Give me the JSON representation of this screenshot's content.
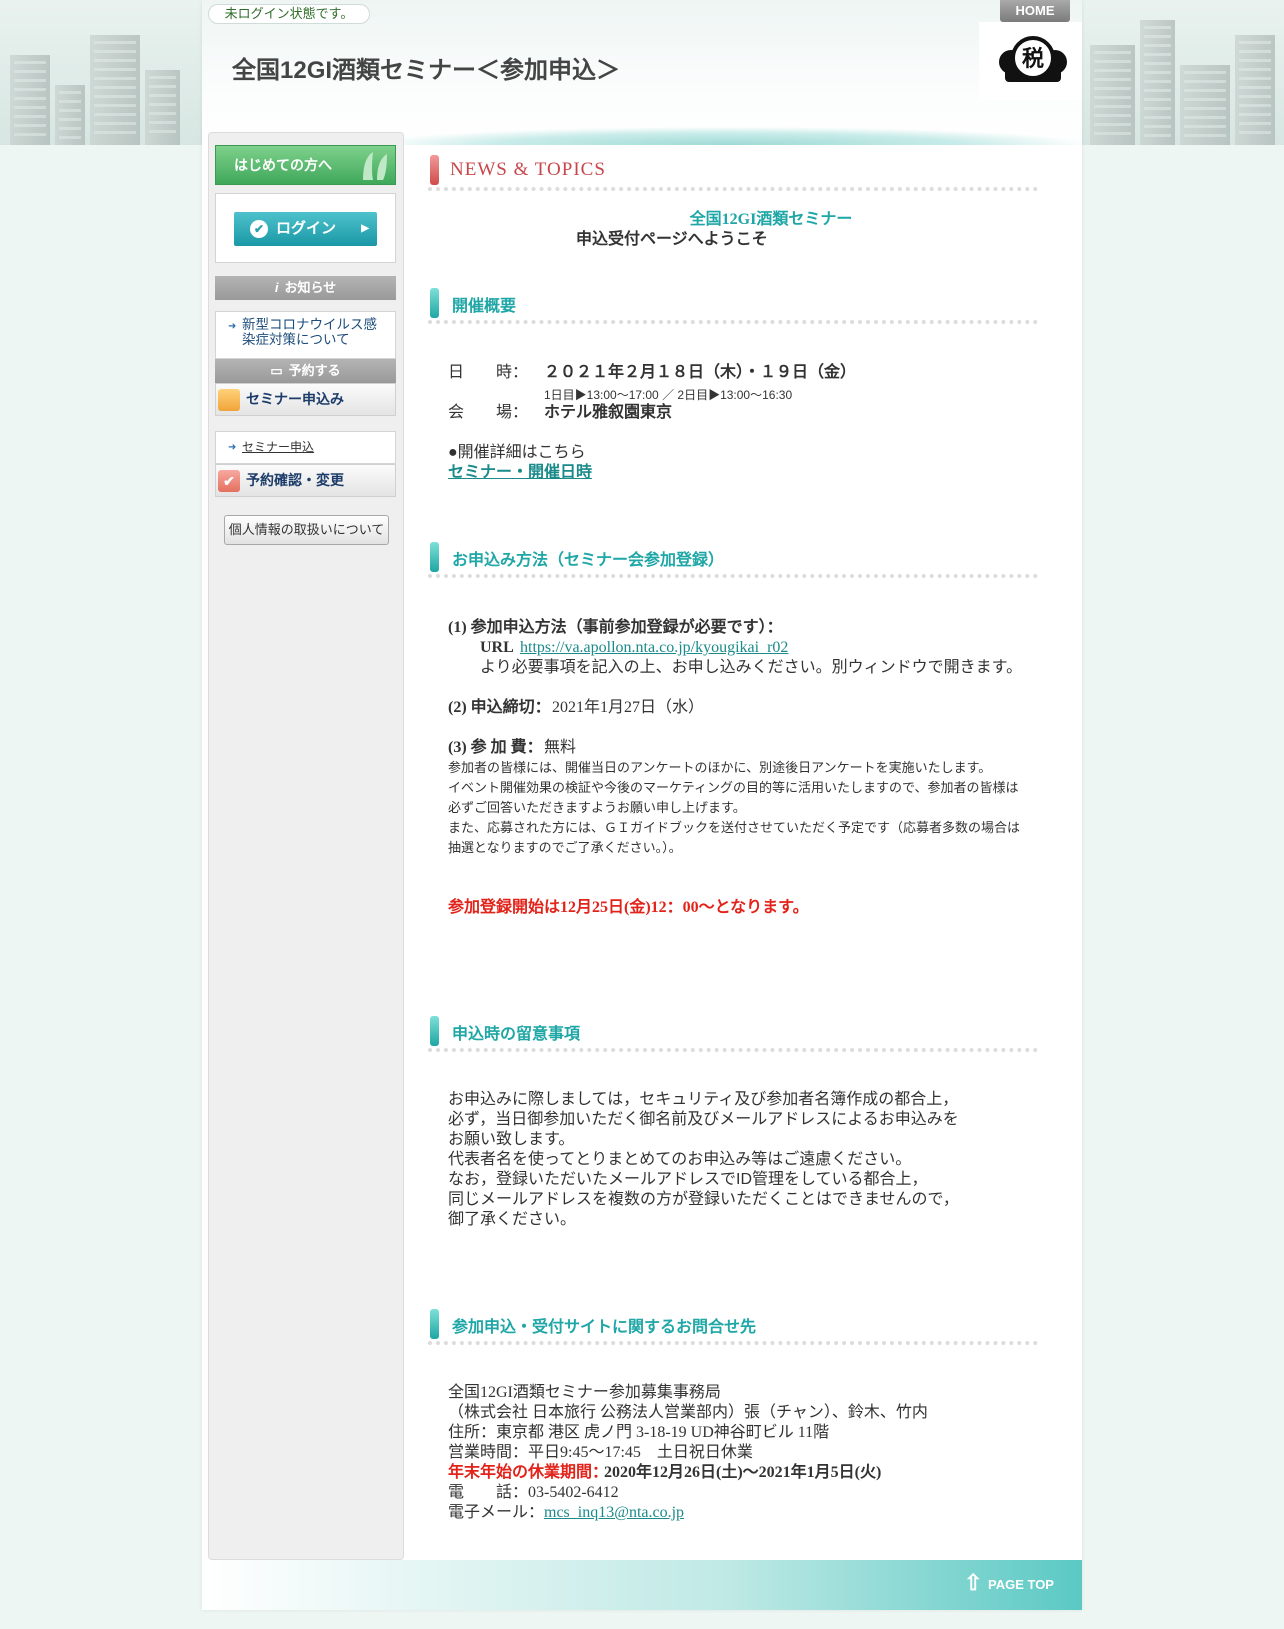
{
  "header": {
    "login_state": "未ログイン状態です。",
    "title": "全国12GI酒類セミナー＜参加申込＞",
    "home": "HOME",
    "logo_text": "税"
  },
  "sidebar": {
    "first_time": "はじめての方へ",
    "login": "ログイン",
    "notice_head": "お知らせ",
    "notice_item": "新型コロナウイルス感染症対策について",
    "reserve_head": "予約する",
    "seminar_apply": "セミナー申込み",
    "seminar_sub": "セミナー申込",
    "confirm_change": "予約確認・変更",
    "privacy": "個人情報の取扱いについて"
  },
  "main": {
    "news_title": "NEWS & TOPICS",
    "welcome_line1": "全国12GI酒類セミナー",
    "welcome_line2": "申込受付ページへようこそ",
    "overview": {
      "heading": "開催概要",
      "date_label": "日　　時：",
      "date_value": "２０２１年２月１８日（木）・１９日（金）",
      "time_value": "1日目▶13:00～17:00 ／ 2日目▶13:00～16:30",
      "venue_label": "会　　場：",
      "venue_value": "ホテル雅叙園東京",
      "details_text": "●開催詳細はこちら",
      "details_link": "セミナー・開催日時"
    },
    "method": {
      "heading": "お申込み方法（セミナー会参加登録）",
      "item1_title": "(1) 参加申込方法（事前参加登録が必要です）：",
      "url_label": "URL",
      "url": "https://va.apollon.nta.co.jp/kyougikai_r02",
      "url_note": "より必要事項を記入の上、お申し込みください。別ウィンドウで開きます。",
      "item2_title": "(2) 申込締切：",
      "item2_value": "2021年1月27日（水）",
      "item3_title": "(3) 参 加 費：",
      "item3_value": "無料",
      "note1": "参加者の皆様には、開催当日のアンケートのほかに、別途後日アンケートを実施いたします。",
      "note2a": "イベント開催効果の検証や今後のマーケティングの目的等に活用いたしますので、参加者の皆様は",
      "note2b": "必ずご回答いただきますようお願い申し上げます。",
      "note3a": "また、応募された方には、ＧＩガイドブックを送付させていただく予定です（応募者多数の場合は",
      "note3b": "抽選となりますのでご了承ください。）。",
      "start_notice": "参加登録開始は12月25日(金)12：00～となります。"
    },
    "caution": {
      "heading": "申込時の留意事項",
      "lines": [
        "お申込みに際しましては，セキュリティ及び参加者名簿作成の都合上，",
        "必ず，当日御参加いただく御名前及びメールアドレスによるお申込みを",
        "お願い致します。",
        "代表者名を使ってとりまとめてのお申込み等はご遠慮ください。",
        "なお，登録いただいたメールアドレスでID管理をしている都合上，",
        "同じメールアドレスを複数の方が登録いただくことはできませんので，",
        "御了承ください。"
      ]
    },
    "contact": {
      "heading": "参加申込・受付サイトに関するお問合せ先",
      "office": "全国12GI酒類セミナー参加募集事務局",
      "company": "（株式会社 日本旅行 公務法人営業部内）張（チャン）、鈴木、竹内",
      "address": "住所：東京都 港区 虎ノ門 3-18-19 UD神谷町ビル 11階",
      "hours": "営業時間：平日9:45～17:45　土日祝日休業",
      "holiday_label": "年末年始の休業期間：",
      "holiday_value": "2020年12月26日(土)～2021年1月5日(火)",
      "phone": "電　　話：03-5402-6412",
      "email_label": "電子メール：",
      "email": "mcs_inq13@nta.co.jp"
    }
  },
  "footer": {
    "page_top": "PAGE TOP"
  },
  "colors": {
    "accent": "#1fa6a6",
    "news": "#c8464a",
    "warning": "#e2231a"
  }
}
